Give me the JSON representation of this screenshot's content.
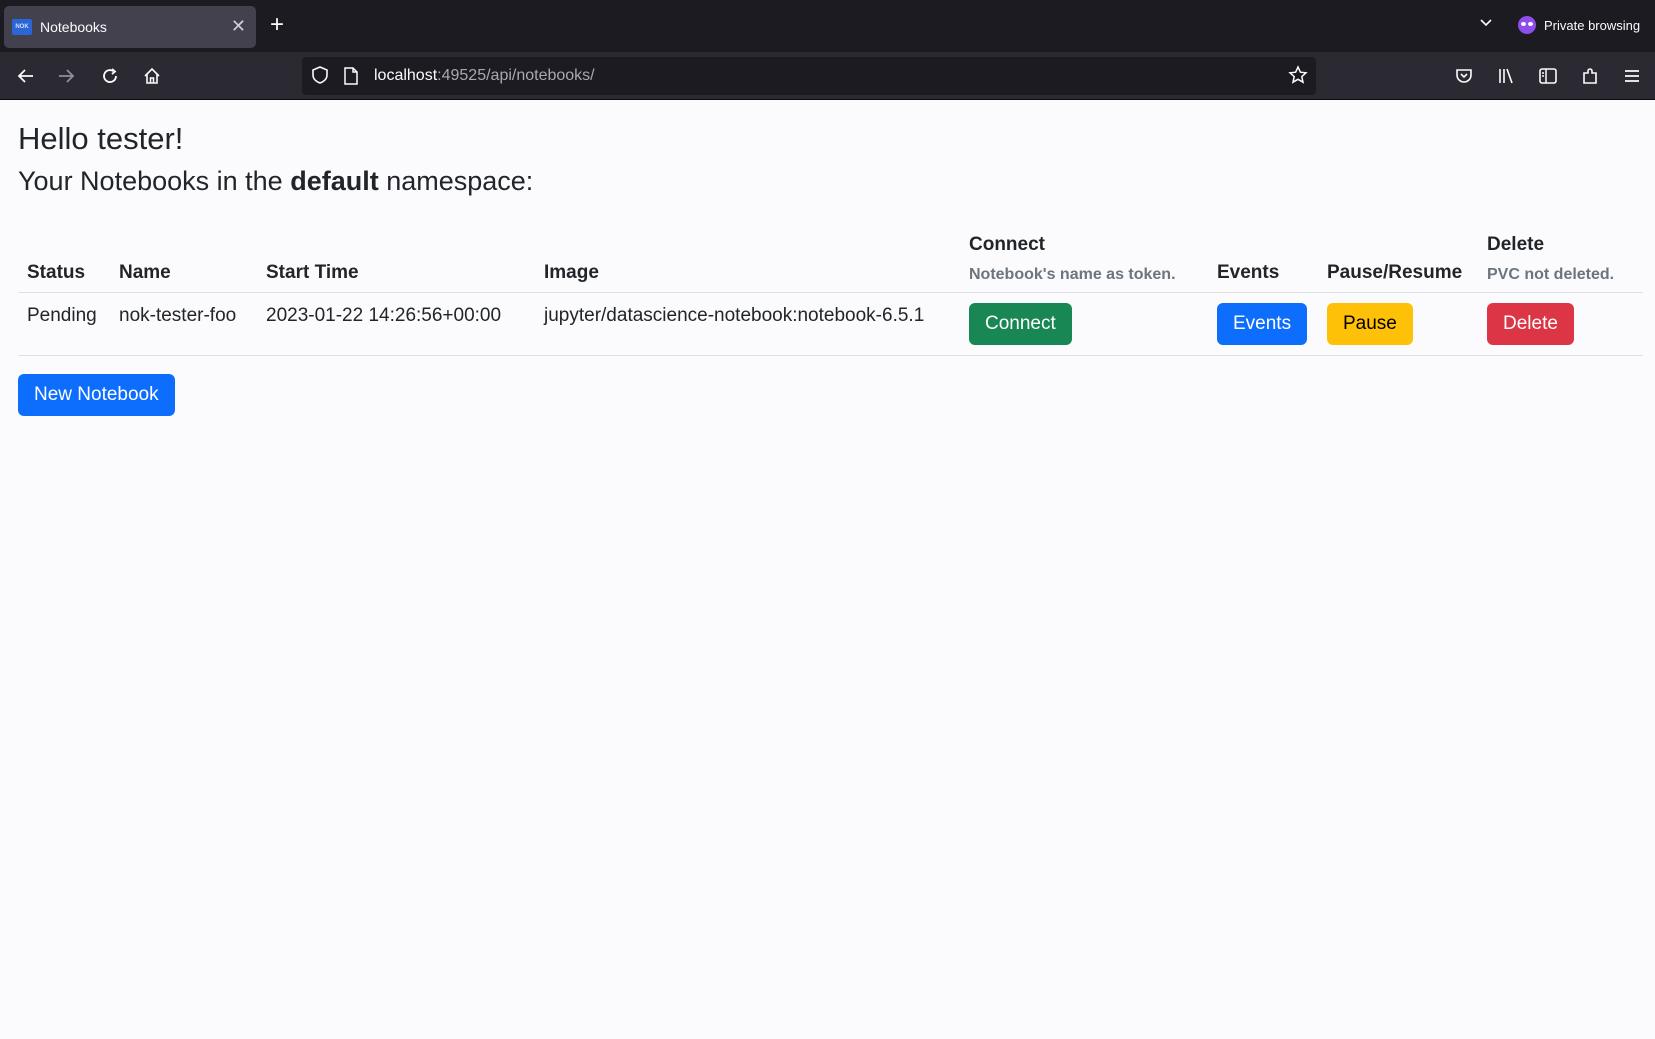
{
  "browser": {
    "tab_title": "Notebooks",
    "tab_favicon_text": "NOK",
    "url_host": "localhost",
    "url_rest": ":49525/api/notebooks/",
    "private_label": "Private browsing"
  },
  "page": {
    "greeting": "Hello tester!",
    "subtitle_prefix": "Your Notebooks in the ",
    "namespace": "default",
    "subtitle_suffix": " namespace:",
    "new_button": "New Notebook"
  },
  "table": {
    "headers": {
      "status": "Status",
      "name": "Name",
      "start_time": "Start Time",
      "image": "Image",
      "connect": "Connect",
      "connect_note": "Notebook's name as token.",
      "events": "Events",
      "pause_resume": "Pause/Resume",
      "delete": "Delete",
      "delete_note": "PVC not deleted."
    },
    "rows": [
      {
        "status": "Pending",
        "name": "nok-tester-foo",
        "start_time": "2023-01-22 14:26:56+00:00",
        "image": "jupyter/datascience-notebook:notebook-6.5.1",
        "connect_label": "Connect",
        "events_label": "Events",
        "pause_label": "Pause",
        "delete_label": "Delete"
      }
    ]
  },
  "colors": {
    "connect": "#198754",
    "events": "#0d6efd",
    "pause": "#ffc107",
    "delete": "#dc3545"
  }
}
